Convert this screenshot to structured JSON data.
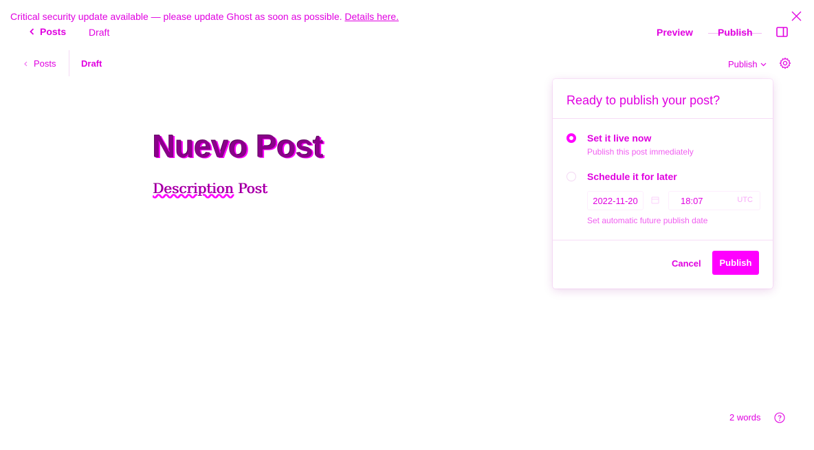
{
  "banner": {
    "message": "Critical security update available — please update Ghost as soon as possible.",
    "link": "Details here."
  },
  "topbar": {
    "back_label": "Posts",
    "status": "Draft",
    "preview_label": "Preview",
    "publish_label": "Publish"
  },
  "editor_header": {
    "back_label": "Posts",
    "status": "Draft",
    "publish_dropdown": "Publish"
  },
  "post": {
    "title": "Nuevo Post",
    "description_word1": "Description",
    "description_word2": "Post"
  },
  "publish_popup": {
    "title": "Ready to publish your post?",
    "options": [
      {
        "label": "Set it live now",
        "help": "Publish this post immediately",
        "selected": true
      },
      {
        "label": "Schedule it for later",
        "help": "Set automatic future publish date",
        "selected": false
      }
    ],
    "schedule": {
      "date": "2022-11-20",
      "time": "18:07",
      "timezone": "UTC"
    },
    "cancel_label": "Cancel",
    "publish_label": "Publish"
  },
  "footer": {
    "word_count": "2 words"
  },
  "colors": {
    "accent": "#ff00ff",
    "text": "#e000e0",
    "title": "#8a008a"
  }
}
